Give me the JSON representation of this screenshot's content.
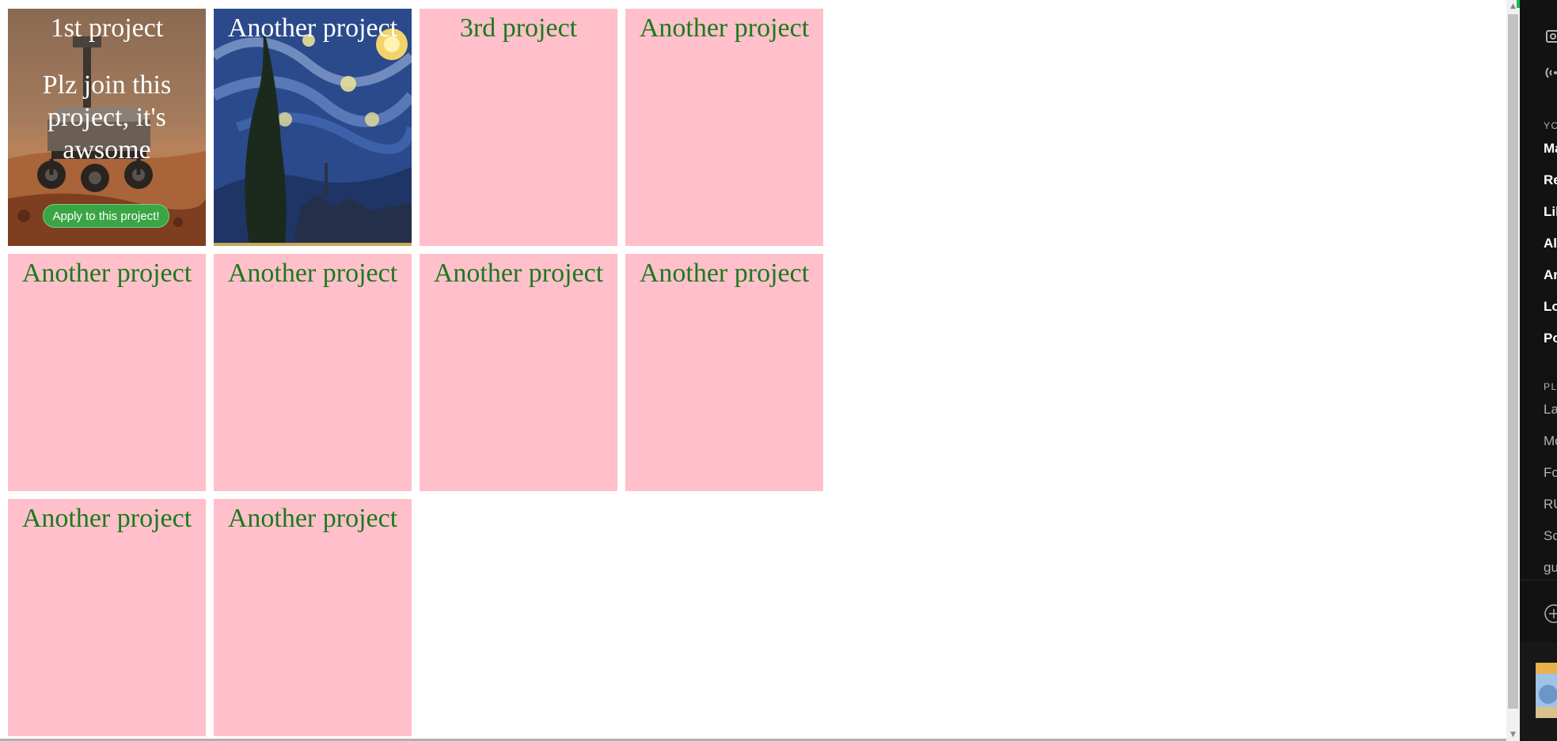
{
  "projects": [
    {
      "title": "1st project",
      "description": "Plz join this project, it's awsome",
      "button": "Apply to this project!",
      "background": "mars-rover-photo"
    },
    {
      "title": "Another project",
      "background": "starry-night-painting"
    },
    {
      "title": "3rd project"
    },
    {
      "title": "Another project"
    },
    {
      "title": "Another project"
    },
    {
      "title": "Another project"
    },
    {
      "title": "Another project"
    },
    {
      "title": "Another project"
    },
    {
      "title": "Another project"
    },
    {
      "title": "Another project"
    }
  ],
  "colors": {
    "card_background": "#ffc0cb",
    "title_green": "#1b7a1b",
    "apply_button": "#3aa544",
    "side_panel": "#121212",
    "accent_green": "#1db954"
  },
  "side_panel": {
    "section_1_heading": "YO",
    "items": [
      "Ma",
      "Re",
      "Lik",
      "Al",
      "Ar",
      "Lo",
      "Po"
    ],
    "section_2_heading": "PL",
    "playlists": [
      "La",
      "Mo",
      "Fo",
      "RU",
      "So",
      "gu"
    ]
  }
}
